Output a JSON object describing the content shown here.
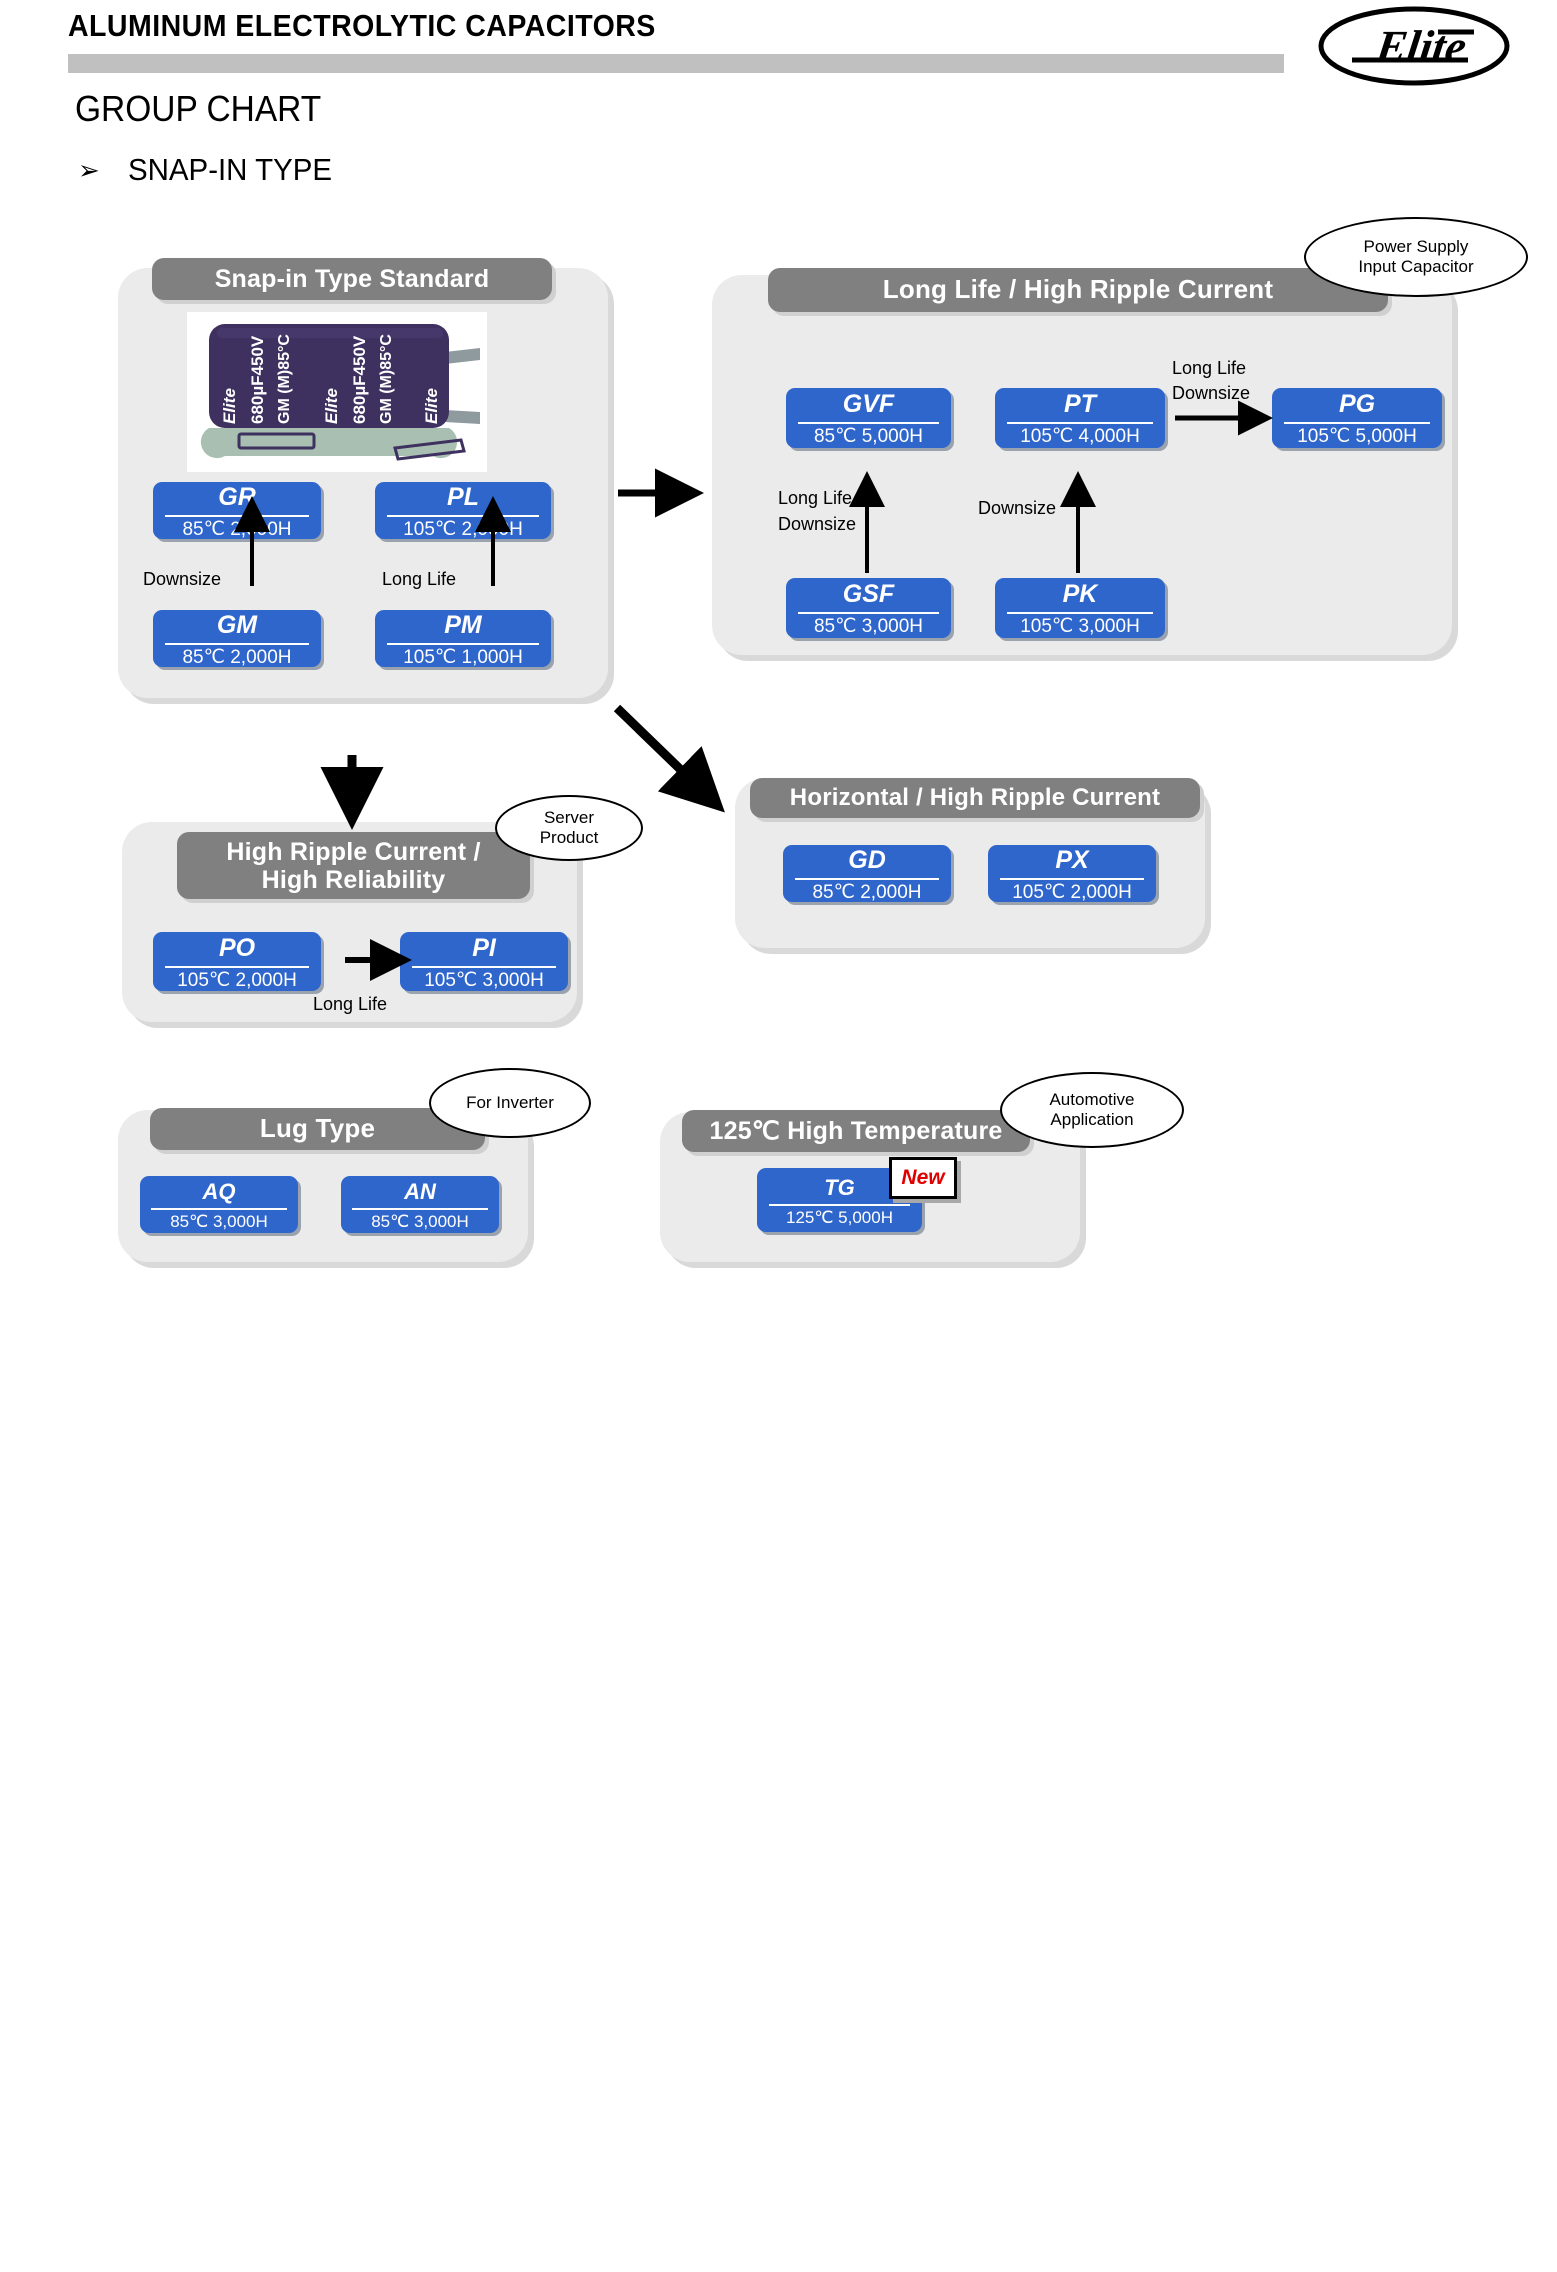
{
  "header": {
    "title": "ALUMINUM ELECTROLYTIC CAPACITORS",
    "logo_text": "Elite",
    "page_title": "GROUP CHART",
    "bullet_glyph": "➢",
    "section_label": "SNAP-IN TYPE"
  },
  "capacitor_photo": {
    "brand": "Elite",
    "line1": "680μF450V",
    "line2": "GM (M)85°C"
  },
  "groups": [
    {
      "id": "snap-in-standard",
      "title": "Snap-in Type Standard",
      "parts": [
        {
          "code": "GR",
          "spec": "85℃ 2,000H"
        },
        {
          "code": "PL",
          "spec": "105℃ 2,000H"
        },
        {
          "code": "GM",
          "spec": "85℃ 2,000H"
        },
        {
          "code": "PM",
          "spec": "105℃ 1,000H"
        }
      ],
      "arrow_labels": [
        "Downsize",
        "Long Life"
      ]
    },
    {
      "id": "long-life-high-ripple",
      "title": "Long Life / High Ripple Current",
      "parts": [
        {
          "code": "GVF",
          "spec": "85℃ 5,000H"
        },
        {
          "code": "PT",
          "spec": "105℃ 4,000H"
        },
        {
          "code": "PG",
          "spec": "105℃ 5,000H"
        },
        {
          "code": "GSF",
          "spec": "85℃ 3,000H"
        },
        {
          "code": "PK",
          "spec": "105℃ 3,000H"
        }
      ],
      "arrow_labels": [
        "Long Life",
        "Downsize",
        "Long Life",
        "Downsize",
        "Downsize"
      ]
    },
    {
      "id": "high-ripple-high-reliability",
      "title_line1": "High Ripple Current /",
      "title_line2": "High Reliability",
      "parts": [
        {
          "code": "PO",
          "spec": "105℃ 2,000H"
        },
        {
          "code": "PI",
          "spec": "105℃ 3,000H"
        }
      ],
      "arrow_labels": [
        "Long Life"
      ]
    },
    {
      "id": "horizontal-high-ripple",
      "title": "Horizontal / High Ripple Current",
      "parts": [
        {
          "code": "GD",
          "spec": "85℃ 2,000H"
        },
        {
          "code": "PX",
          "spec": "105℃ 2,000H"
        }
      ]
    },
    {
      "id": "lug-type",
      "title": "Lug Type",
      "parts": [
        {
          "code": "AQ",
          "spec": "85℃ 3,000H"
        },
        {
          "code": "AN",
          "spec": "85℃ 3,000H"
        }
      ]
    },
    {
      "id": "high-temperature-125",
      "title": "125℃ High Temperature",
      "parts": [
        {
          "code": "TG",
          "spec": "125℃ 5,000H"
        }
      ],
      "badge": "New"
    }
  ],
  "callouts": [
    {
      "id": "power-supply",
      "line1": "Power Supply",
      "line2": "Input Capacitor"
    },
    {
      "id": "server",
      "line1": "Server",
      "line2": "Product"
    },
    {
      "id": "inverter",
      "line1": "For Inverter",
      "line2": ""
    },
    {
      "id": "automotive",
      "line1": "Automotive",
      "line2": "Application"
    }
  ],
  "labels": {
    "snapin_downsize": "Downsize",
    "snapin_longlife": "Long Life",
    "ll_gsf_l1": "Long Life",
    "ll_gsf_l2": "Downsize",
    "ll_pk": "Downsize",
    "ll_pg_l1": "Long Life",
    "ll_pg_l2": "Downsize",
    "po_pi": "Long Life"
  },
  "colors": {
    "chip_blue": "#2f66cc",
    "panel_gray": "#ebebeb",
    "header_gray": "#808080",
    "rule_gray": "#c0c0c0",
    "new_red": "#e00000"
  }
}
